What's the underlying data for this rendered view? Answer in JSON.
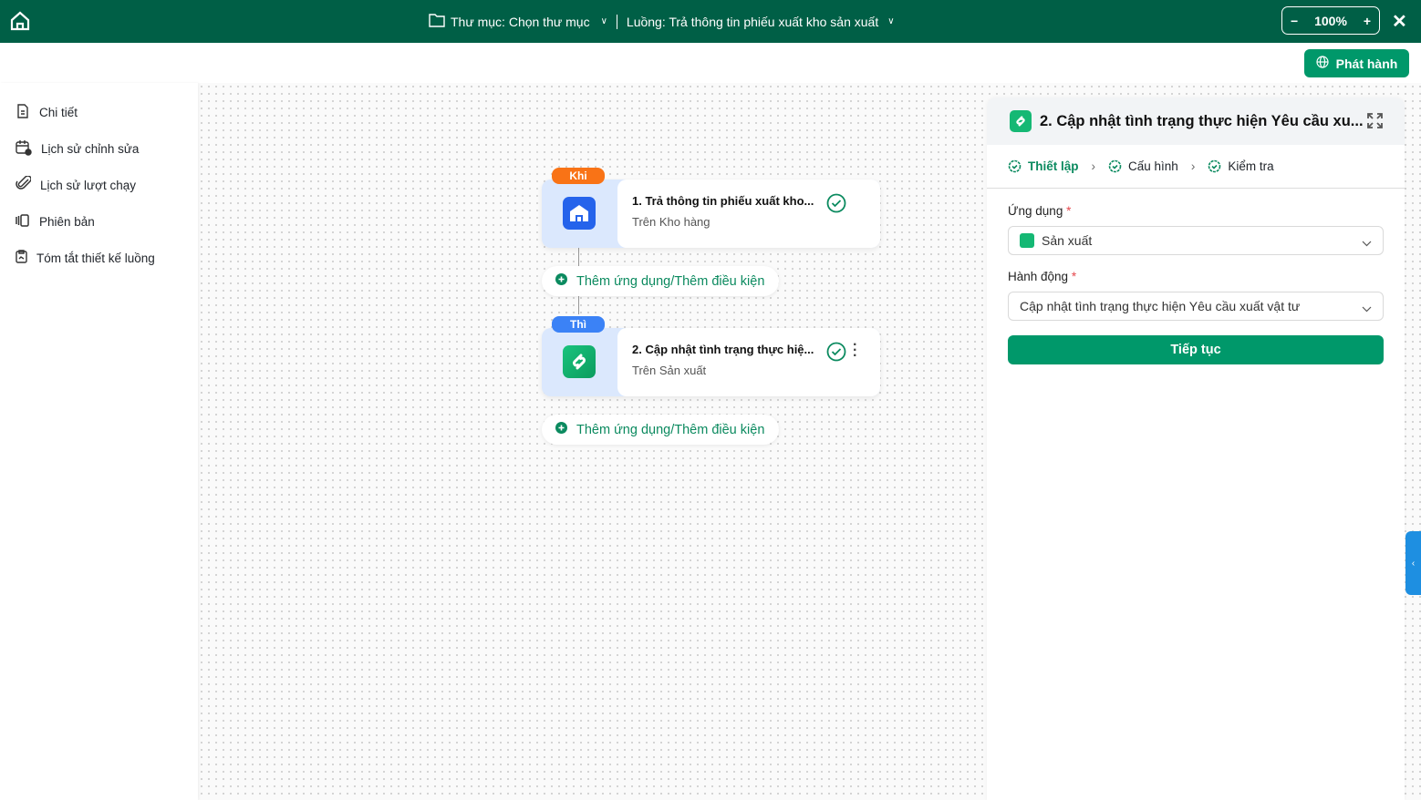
{
  "header": {
    "folder_label": "Thư mục: Chọn thư mục",
    "flow_label": "Luồng: Trả thông tin phiếu xuất kho sản xuất",
    "zoom": "100%",
    "publish_label": "Phát hành"
  },
  "sidebar": {
    "items": [
      {
        "label": "Chi tiết"
      },
      {
        "label": "Lịch sử chỉnh sửa"
      },
      {
        "label": "Lịch sử lượt chạy"
      },
      {
        "label": "Phiên bản"
      },
      {
        "label": "Tóm tắt thiết kế luồng"
      }
    ]
  },
  "flow": {
    "nodes": [
      {
        "tag": "Khi",
        "title": "1.  Trả thông tin phiếu xuất kho...",
        "subtitle": "Trên Kho hàng"
      },
      {
        "tag": "Thì",
        "title": "2.  Cập nhật tình trạng thực hiệ...",
        "subtitle": "Trên Sản xuất"
      }
    ],
    "add_label": "Thêm ứng dụng/Thêm điều kiện"
  },
  "panel": {
    "title": "2. Cập nhật tình trạng thực hiện Yêu cầu xu...",
    "steps": [
      "Thiết lập",
      "Cấu hình",
      "Kiểm tra"
    ],
    "app_label": "Ứng dụng",
    "app_value": "Sản xuất",
    "action_label": "Hành động",
    "action_value": "Cập nhật tình trạng thực hiện Yêu cầu xuất vật tư",
    "required": "*",
    "continue_label": "Tiếp tục"
  },
  "colors": {
    "header": "#005f46",
    "primary": "#00986a",
    "khi": "#f97316",
    "thi": "#3b82f6"
  }
}
